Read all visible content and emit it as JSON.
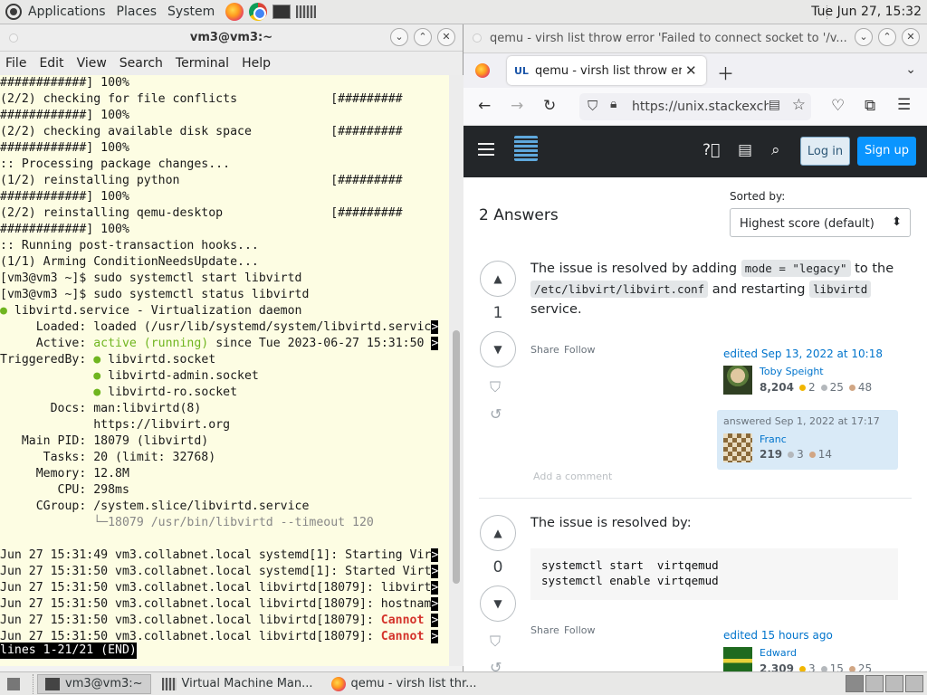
{
  "top_panel": {
    "applications": "Applications",
    "places": "Places",
    "system": "System",
    "clock": "Tue Jun 27, 15:32"
  },
  "terminal": {
    "title": "vm3@vm3:~",
    "menu": [
      "File",
      "Edit",
      "View",
      "Search",
      "Terminal",
      "Help"
    ],
    "lines": [
      "############] 100%",
      "(2/2) checking for file conflicts             [#########",
      "############] 100%",
      "(2/2) checking available disk space           [#########",
      "############] 100%",
      ":: Processing package changes...",
      "(1/2) reinstalling python                     [#########",
      "############] 100%",
      "(2/2) reinstalling qemu-desktop               [#########",
      "############] 100%",
      ":: Running post-transaction hooks...",
      "(1/1) Arming ConditionNeedsUpdate...",
      "[vm3@vm3 ~]$ sudo systemctl start libvirtd",
      "[vm3@vm3 ~]$ sudo systemctl status libvirtd"
    ],
    "status": {
      "service": "libvirtd.service - Virtualization daemon",
      "loaded": "     Loaded: loaded (/usr/lib/systemd/system/libvirtd.servic",
      "active_label": "     Active: ",
      "active_value": "active (running)",
      "active_rest": " since Tue 2023-06-27 15:31:50 ",
      "triggered": [
        "TriggeredBy: ",
        "             ",
        "             "
      ],
      "sockets": [
        "libvirtd.socket",
        "libvirtd-admin.socket",
        "libvirtd-ro.socket"
      ],
      "docs1": "       Docs: man:libvirtd(8)",
      "docs2": "             https://libvirt.org",
      "mainpid": "   Main PID: 18079 (libvirtd)",
      "tasks": "      Tasks: 20 (limit: 32768)",
      "memory": "     Memory: 12.8M",
      "cpu": "        CPU: 298ms",
      "cgroup": "     CGroup: /system.slice/libvirtd.service",
      "cgroup_child": "             └─18079 /usr/bin/libvirtd --timeout 120"
    },
    "journal": [
      {
        "text": "Jun 27 15:31:49 vm3.collabnet.local systemd[1]: Starting Vir",
        "red": ""
      },
      {
        "text": "Jun 27 15:31:50 vm3.collabnet.local systemd[1]: Started Virt",
        "red": ""
      },
      {
        "text": "Jun 27 15:31:50 vm3.collabnet.local libvirtd[18079]: libvirt",
        "red": ""
      },
      {
        "text": "Jun 27 15:31:50 vm3.collabnet.local libvirtd[18079]: hostnam",
        "red": ""
      },
      {
        "text": "Jun 27 15:31:50 vm3.collabnet.local libvirtd[18079]: ",
        "red": "Cannot "
      },
      {
        "text": "Jun 27 15:31:50 vm3.collabnet.local libvirtd[18079]: ",
        "red": "Cannot "
      }
    ],
    "pager_status": "lines 1-21/21 (END)",
    "trunc_marker": ">"
  },
  "browser": {
    "window_title": "qemu - virsh list throw error 'Failed to connect socket to '/v...",
    "tab_title": "qemu - virsh list throw error",
    "url": "https://unix.stackexch",
    "login": "Log in",
    "signup": "Sign up",
    "answers_count": "2 Answers",
    "sorted_by_label": "Sorted by:",
    "sort_value": "Highest score (default)",
    "answer1": {
      "votes": "1",
      "text_a": "The issue is resolved by adding ",
      "code_a": "mode = \"legacy\"",
      "text_b": " to the",
      "code_b": "/etc/libvirt/libvirt.conf",
      "text_c": " and restarting ",
      "code_c": "libvirtd",
      "text_d": "service.",
      "share": "Share",
      "follow": "Follow",
      "edited": "edited Sep 13, 2022 at 10:18",
      "editor": "Toby Speight",
      "editor_rep": "8,204",
      "editor_badges": [
        "2",
        "25",
        "48"
      ],
      "answered": "answered Sep 1, 2022 at 17:17",
      "author": "Franc",
      "author_rep": "219",
      "author_badges": [
        "3",
        "14"
      ],
      "add_comment": "Add a comment"
    },
    "answer2": {
      "votes": "0",
      "text": "The issue is resolved by:",
      "code": "systemctl start  virtqemud\nsystemctl enable virtqemud",
      "share": "Share",
      "follow": "Follow",
      "edited": "edited 15 hours ago",
      "editor": "Edward",
      "editor_rep": "2,309",
      "editor_badges": [
        "3",
        "15",
        "25"
      ]
    }
  },
  "taskbar": {
    "items": [
      "vm3@vm3:~",
      "Virtual Machine Man...",
      "qemu - virsh list thr..."
    ]
  },
  "colors": {
    "accent": "#0a95ff",
    "console_bg": "#fdfde3",
    "green": "#6fb51f",
    "red": "#d4332b"
  }
}
